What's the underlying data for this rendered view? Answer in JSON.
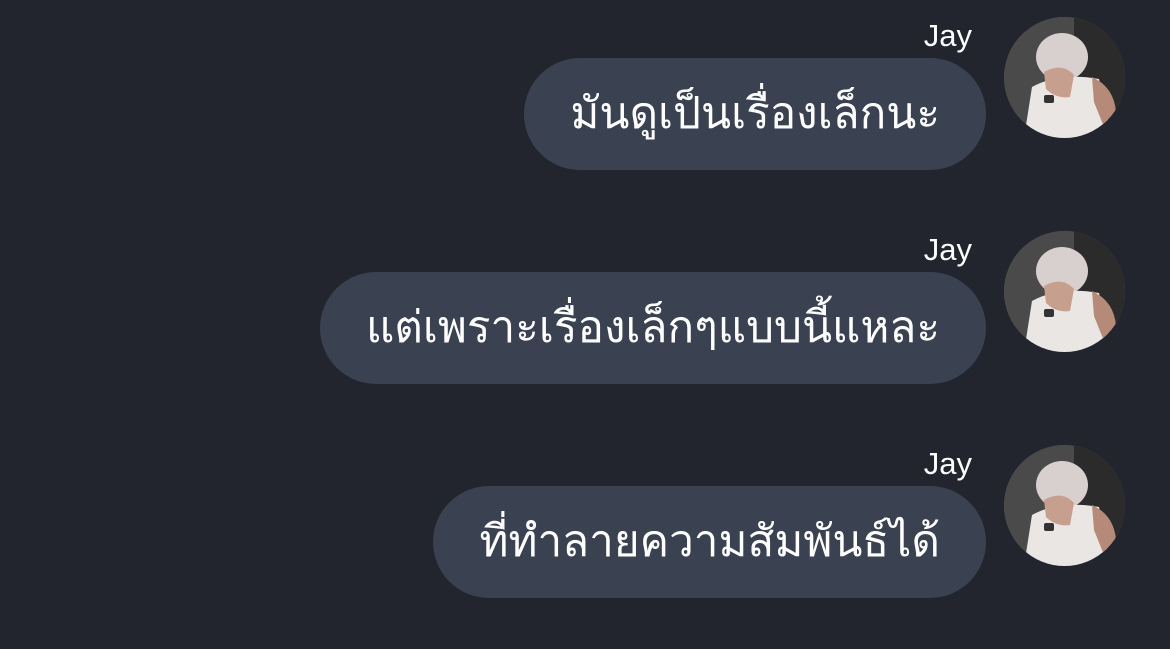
{
  "messages": [
    {
      "sender": "Jay",
      "text": "มันดูเป็นเรื่องเล็กนะ"
    },
    {
      "sender": "Jay",
      "text": "แต่เพราะเรื่องเล็กๆแบบนี้แหละ"
    },
    {
      "sender": "Jay",
      "text": "ที่ทำลายความสัมพันธ์ได้"
    }
  ],
  "colors": {
    "background": "#22252d",
    "bubble": "#3a4252",
    "text": "#ffffff"
  }
}
